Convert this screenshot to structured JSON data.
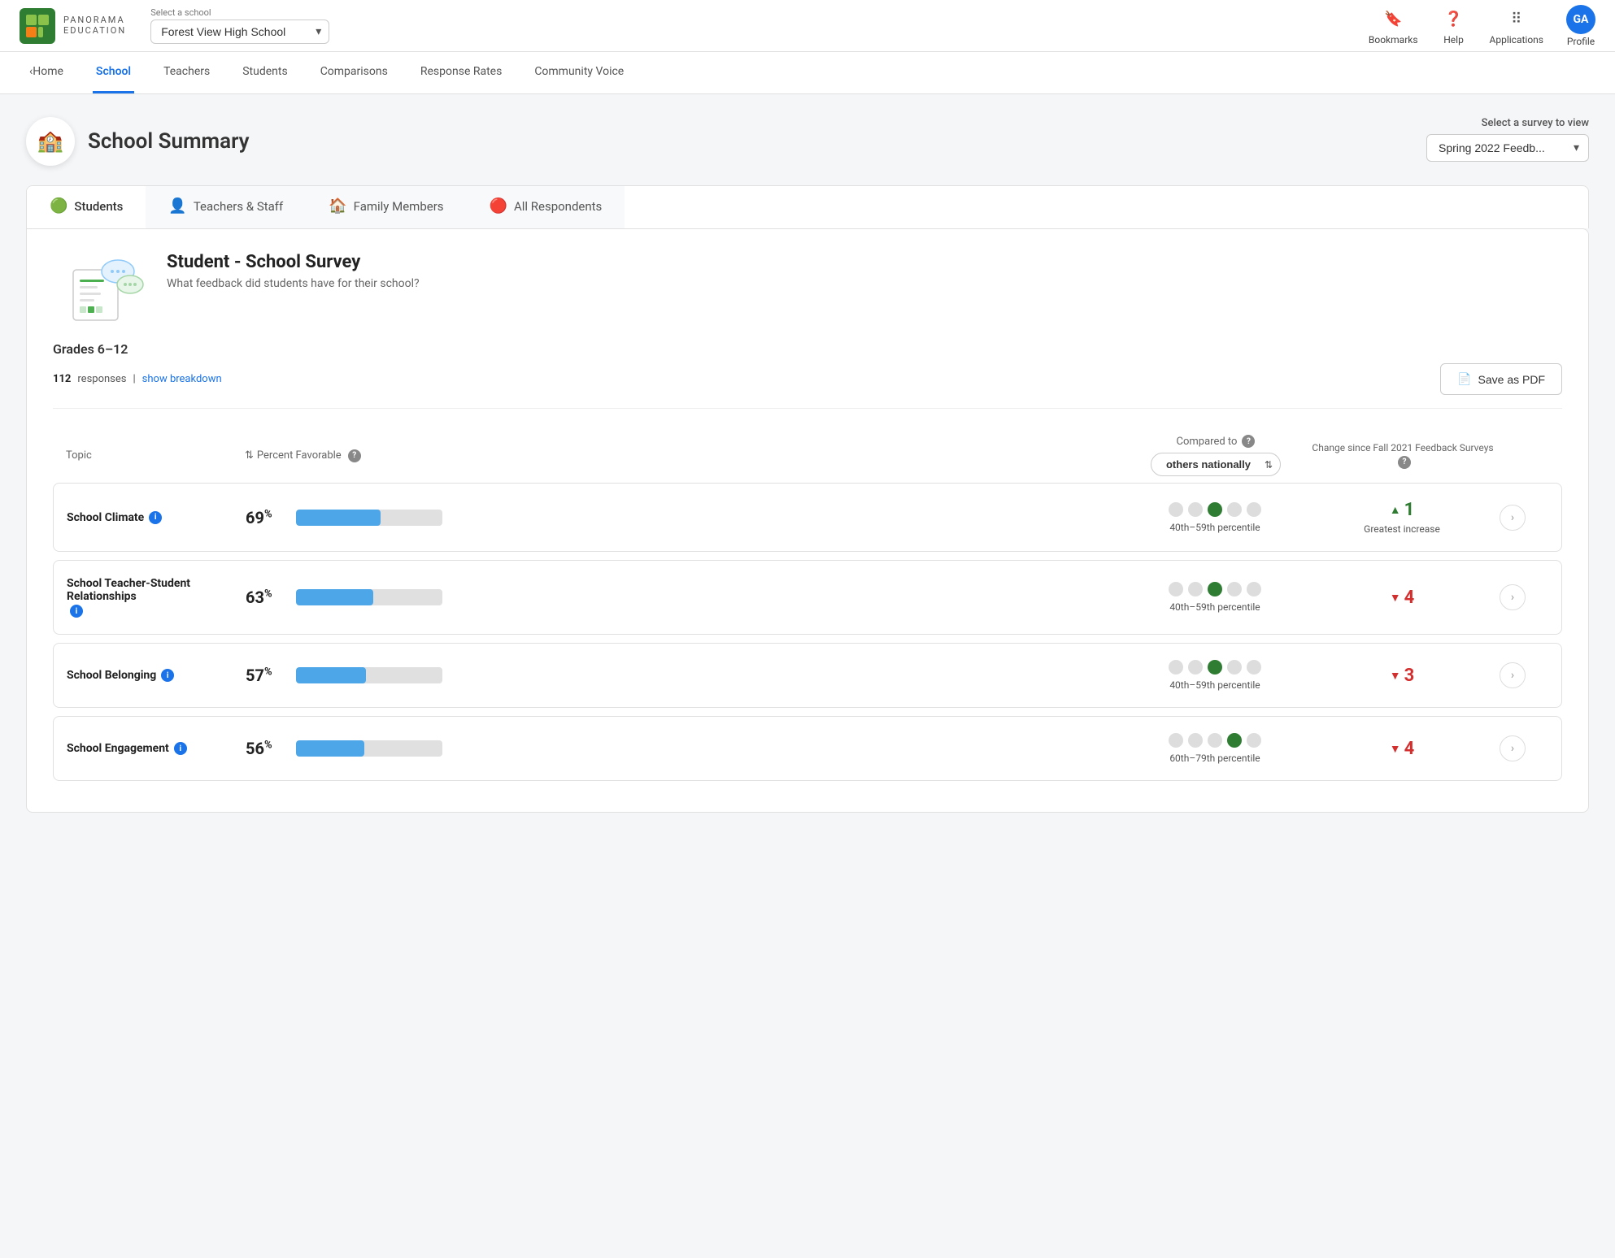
{
  "topNav": {
    "logoText": "PANORAMA",
    "logoSubText": "EDUCATION",
    "selectSchoolLabel": "Select a school",
    "schoolName": "Forest View High School",
    "bookmarksLabel": "Bookmarks",
    "helpLabel": "Help",
    "applicationsLabel": "Applications",
    "profileLabel": "Profile",
    "profileInitials": "GA"
  },
  "secondaryNav": {
    "items": [
      {
        "label": "Home",
        "id": "home",
        "active": false
      },
      {
        "label": "School",
        "id": "school",
        "active": true
      },
      {
        "label": "Teachers",
        "id": "teachers",
        "active": false
      },
      {
        "label": "Students",
        "id": "students",
        "active": false
      },
      {
        "label": "Comparisons",
        "id": "comparisons",
        "active": false
      },
      {
        "label": "Response Rates",
        "id": "response-rates",
        "active": false
      },
      {
        "label": "Community Voice",
        "id": "community-voice",
        "active": false
      }
    ]
  },
  "pageHeader": {
    "title": "School Summary",
    "selectSurveyLabel": "Select a survey to view",
    "selectedSurvey": "Spring 2022 Feedb..."
  },
  "tabs": [
    {
      "label": "Students",
      "icon": "🟢",
      "active": true
    },
    {
      "label": "Teachers & Staff",
      "icon": "👤",
      "active": false
    },
    {
      "label": "Family Members",
      "icon": "🏠",
      "active": false
    },
    {
      "label": "All Respondents",
      "icon": "🔴",
      "active": false
    }
  ],
  "surveyCard": {
    "title": "Student - School Survey",
    "subtitle": "What feedback did students have for their school?",
    "grades": "Grades 6–12",
    "responsesCount": "112",
    "responsesLabel": "responses",
    "showBreakdownLabel": "show breakdown",
    "savePdfLabel": "Save as PDF",
    "tableHeaders": {
      "topic": "Topic",
      "percentFavorable": "Percent Favorable",
      "comparedTo": "Compared to",
      "changeSince": "Change since Fall 2021 Feedback Surveys"
    },
    "comparedToValue": "others nationally",
    "rows": [
      {
        "id": "school-climate",
        "topic": "School Climate",
        "percent": 69,
        "percentLabel": "69",
        "percentileDots": [
          0,
          0,
          1,
          0,
          0
        ],
        "percentileLabel": "40th–59th percentile",
        "changeValue": "1",
        "changeDirection": "up",
        "changeLabel": "Greatest increase"
      },
      {
        "id": "teacher-student",
        "topic": "School Teacher-Student Relationships",
        "percent": 63,
        "percentLabel": "63",
        "percentileDots": [
          0,
          0,
          1,
          0,
          0
        ],
        "percentileLabel": "40th–59th percentile",
        "changeValue": "4",
        "changeDirection": "down",
        "changeLabel": ""
      },
      {
        "id": "school-belonging",
        "topic": "School Belonging",
        "percent": 57,
        "percentLabel": "57",
        "percentileDots": [
          0,
          0,
          1,
          0,
          0
        ],
        "percentileLabel": "40th–59th percentile",
        "changeValue": "3",
        "changeDirection": "down",
        "changeLabel": ""
      },
      {
        "id": "school-engagement",
        "topic": "School Engagement",
        "percent": 56,
        "percentLabel": "56",
        "percentileDots": [
          0,
          0,
          0,
          1,
          0
        ],
        "percentileLabel": "60th–79th percentile",
        "changeValue": "4",
        "changeDirection": "down",
        "changeLabel": ""
      }
    ]
  }
}
